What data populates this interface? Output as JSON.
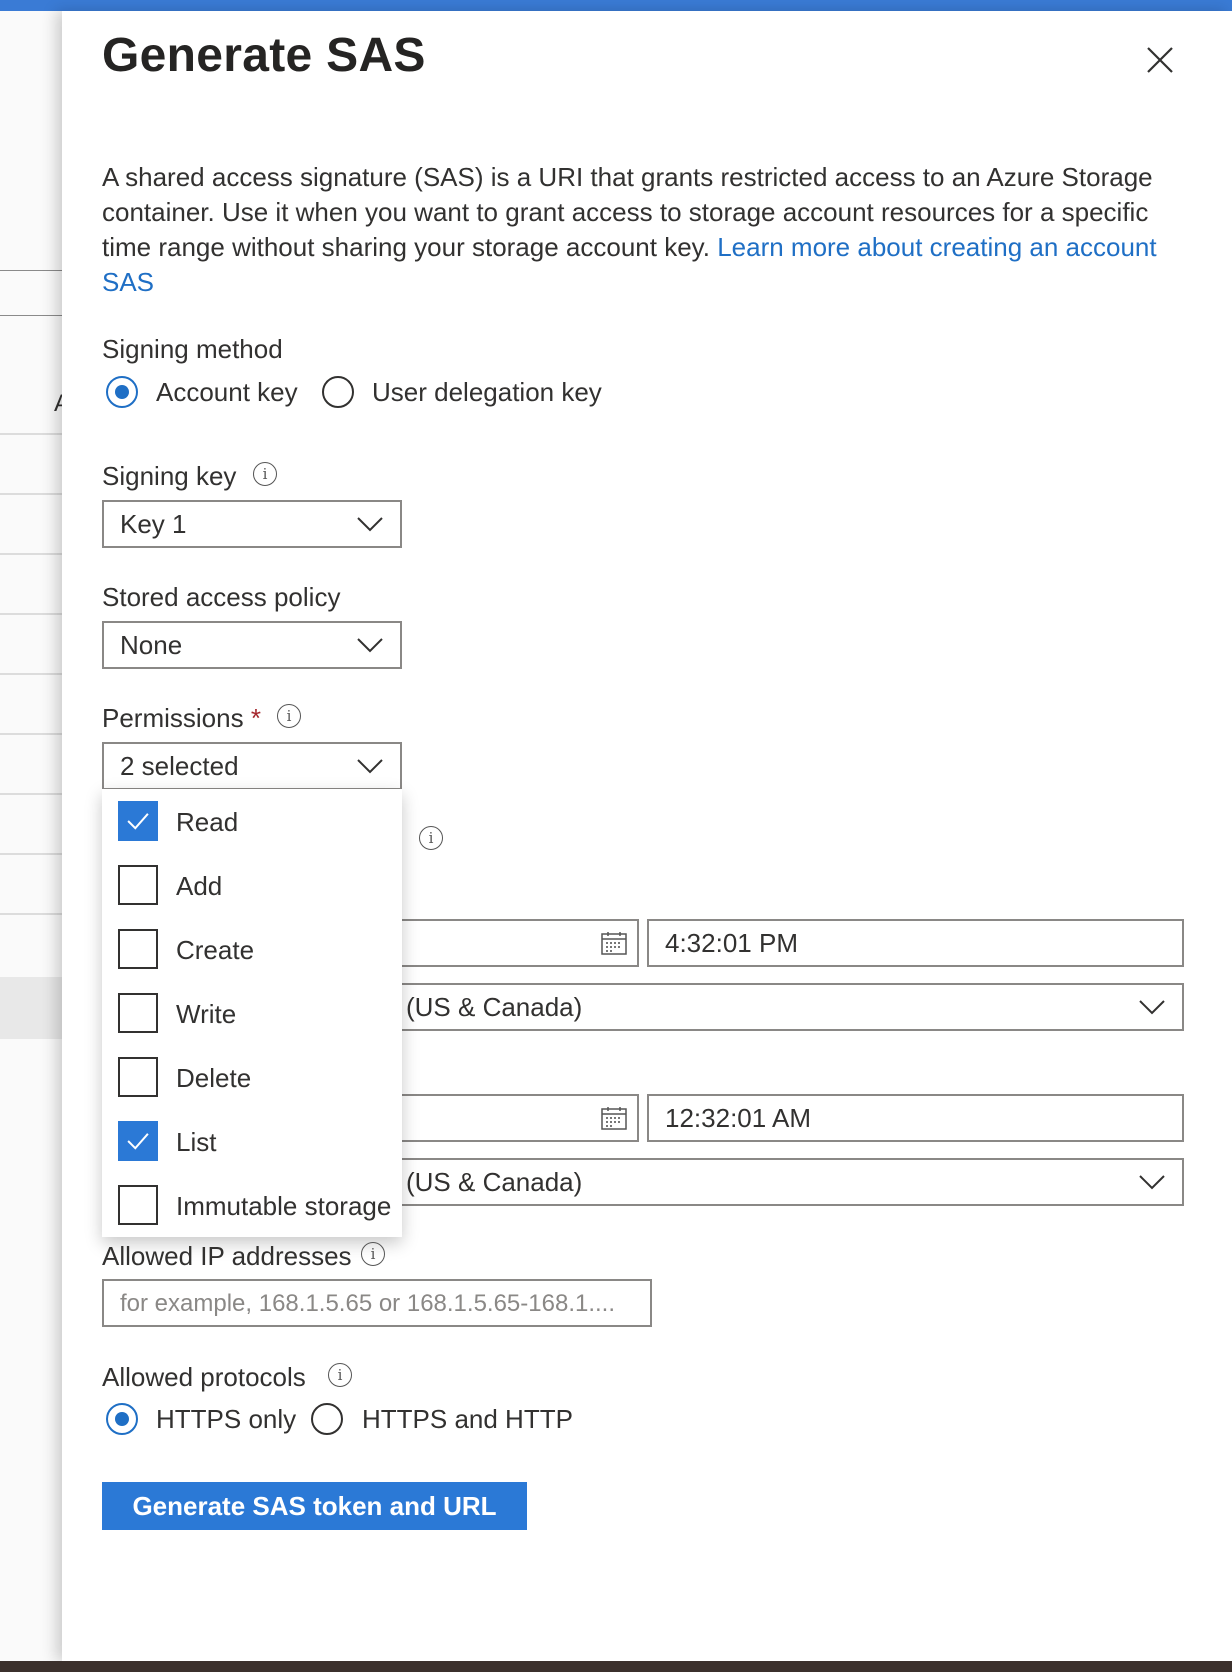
{
  "dialog": {
    "title": "Generate SAS",
    "description": "A shared access signature (SAS) is a URI that grants restricted access to an Azure Storage container. Use it when you want to grant access to storage account resources for a specific time range without sharing your storage account key. ",
    "learn_more_link": "Learn more about creating an account SAS"
  },
  "signing_method": {
    "label": "Signing method",
    "options": [
      "Account key",
      "User delegation key"
    ],
    "selected": "Account key"
  },
  "signing_key": {
    "label": "Signing key",
    "value": "Key 1"
  },
  "stored_access_policy": {
    "label": "Stored access policy",
    "value": "None"
  },
  "permissions": {
    "label": "Permissions",
    "required_mark": "*",
    "value": "2 selected",
    "options": [
      {
        "label": "Read",
        "checked": true
      },
      {
        "label": "Add",
        "checked": false
      },
      {
        "label": "Create",
        "checked": false
      },
      {
        "label": "Write",
        "checked": false
      },
      {
        "label": "Delete",
        "checked": false
      },
      {
        "label": "List",
        "checked": true
      },
      {
        "label": "Immutable storage",
        "checked": false
      }
    ]
  },
  "start": {
    "time": "4:32:01 PM",
    "timezone": "(US & Canada)"
  },
  "expiry": {
    "time": "12:32:01 AM",
    "timezone": "(US & Canada)"
  },
  "allowed_ip": {
    "label": "Allowed IP addresses",
    "placeholder": "for example, 168.1.5.65 or 168.1.5.65-168.1...."
  },
  "allowed_protocols": {
    "label": "Allowed protocols",
    "options": [
      "HTTPS only",
      "HTTPS and HTTP"
    ],
    "selected": "HTTPS only"
  },
  "generate_button": "Generate SAS token and URL",
  "colors": {
    "accent": "#2b79d6",
    "link": "#1f6fc5",
    "required": "#a4262c",
    "top_bar": "#3a7bd5"
  }
}
